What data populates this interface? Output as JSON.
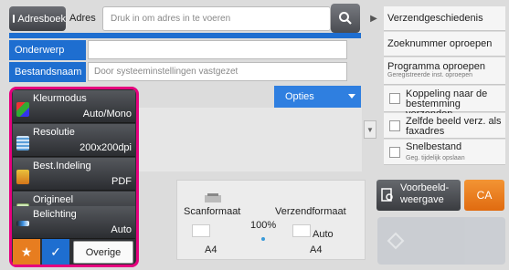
{
  "address": {
    "book_label": "Adresboek",
    "label": "Adres",
    "placeholder": "Druk in om adres in te voeren"
  },
  "fields": {
    "subject_label": "Onderwerp",
    "filename_label": "Bestandsnaam",
    "filename_value": "Door systeeminstellingen vastgezet"
  },
  "settings": [
    {
      "name": "Kleurmodus",
      "value": "Auto/Mono"
    },
    {
      "name": "Resolutie",
      "value": "200x200dpi"
    },
    {
      "name": "Best.Indeling",
      "value": "PDF"
    },
    {
      "name": "Origineel",
      "value": ""
    },
    {
      "name": "Belichting",
      "value": "Auto"
    }
  ],
  "other_label": "Overige",
  "options_label": "Opties",
  "summary": {
    "scan_label": "Scanformaat",
    "send_label": "Verzendformaat",
    "ratio": "100%",
    "send_auto": "Auto",
    "scan_size": "A4",
    "send_size": "A4"
  },
  "right_menu": {
    "history": "Verzendgeschiedenis",
    "search_number": "Zoeknummer oproepen",
    "call_program": "Programma oproepen",
    "call_program_sub": "Geregistreerde inst. oproepen",
    "link": "Koppeling naar de bestemming verzenden",
    "same_image": "Zelfde beeld verz. als faxadres",
    "quick_file": "Snelbestand",
    "quick_file_sub": "Geg. tijdelijk opslaan"
  },
  "preview_label": "Voorbeeld-weergave",
  "ca_label": "CA",
  "colors": {
    "accent": "#1e6ed0",
    "highlight": "#e5007e",
    "ca": "#f08a24"
  }
}
